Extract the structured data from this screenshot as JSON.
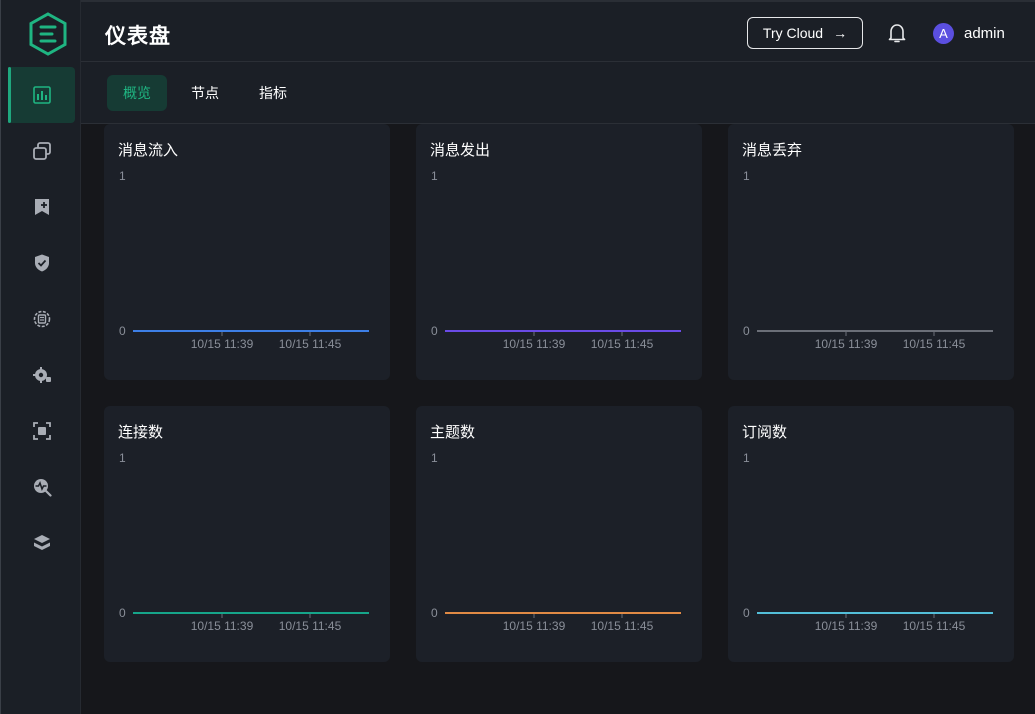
{
  "header": {
    "title": "仪表盘",
    "try_cloud_label": "Try Cloud",
    "avatar_initial": "A",
    "username": "admin"
  },
  "tabs": [
    {
      "label": "概览",
      "active": true
    },
    {
      "label": "节点",
      "active": false
    },
    {
      "label": "指标",
      "active": false
    }
  ],
  "sidebar": {
    "items": [
      {
        "icon": "dashboard-icon",
        "active": true
      },
      {
        "icon": "clients-icon",
        "active": false
      },
      {
        "icon": "subscriptions-icon",
        "active": false
      },
      {
        "icon": "shield-icon",
        "active": false
      },
      {
        "icon": "integration-icon",
        "active": false
      },
      {
        "icon": "settings-icon",
        "active": false
      },
      {
        "icon": "extensions-icon",
        "active": false
      },
      {
        "icon": "diagnose-icon",
        "active": false
      },
      {
        "icon": "system-icon",
        "active": false
      }
    ]
  },
  "chart_data": [
    {
      "type": "line",
      "title": "消息流入",
      "color": "#3d7fe6",
      "y_ticks": [
        "0",
        "1"
      ],
      "x_ticks": [
        "10/15 11:39",
        "10/15 11:45"
      ],
      "ylim": [
        0,
        1
      ],
      "x": [
        "10/15 11:39",
        "10/15 11:45"
      ],
      "values": [
        0,
        0
      ]
    },
    {
      "type": "line",
      "title": "消息发出",
      "color": "#6a4be6",
      "y_ticks": [
        "0",
        "1"
      ],
      "x_ticks": [
        "10/15 11:39",
        "10/15 11:45"
      ],
      "ylim": [
        0,
        1
      ],
      "x": [
        "10/15 11:39",
        "10/15 11:45"
      ],
      "values": [
        0,
        0
      ]
    },
    {
      "type": "line",
      "title": "消息丢弃",
      "color": "#6b6f78",
      "y_ticks": [
        "0",
        "1"
      ],
      "x_ticks": [
        "10/15 11:39",
        "10/15 11:45"
      ],
      "ylim": [
        0,
        1
      ],
      "x": [
        "10/15 11:39",
        "10/15 11:45"
      ],
      "values": [
        0,
        0
      ]
    },
    {
      "type": "line",
      "title": "连接数",
      "color": "#16a58a",
      "y_ticks": [
        "0",
        "1"
      ],
      "x_ticks": [
        "10/15 11:39",
        "10/15 11:45"
      ],
      "ylim": [
        0,
        1
      ],
      "x": [
        "10/15 11:39",
        "10/15 11:45"
      ],
      "values": [
        0,
        0
      ]
    },
    {
      "type": "line",
      "title": "主题数",
      "color": "#e08a45",
      "y_ticks": [
        "0",
        "1"
      ],
      "x_ticks": [
        "10/15 11:39",
        "10/15 11:45"
      ],
      "ylim": [
        0,
        1
      ],
      "x": [
        "10/15 11:39",
        "10/15 11:45"
      ],
      "values": [
        0,
        0
      ]
    },
    {
      "type": "line",
      "title": "订阅数",
      "color": "#53bed8",
      "y_ticks": [
        "0",
        "1"
      ],
      "x_ticks": [
        "10/15 11:39",
        "10/15 11:45"
      ],
      "ylim": [
        0,
        1
      ],
      "x": [
        "10/15 11:39",
        "10/15 11:45"
      ],
      "values": [
        0,
        0
      ]
    }
  ]
}
